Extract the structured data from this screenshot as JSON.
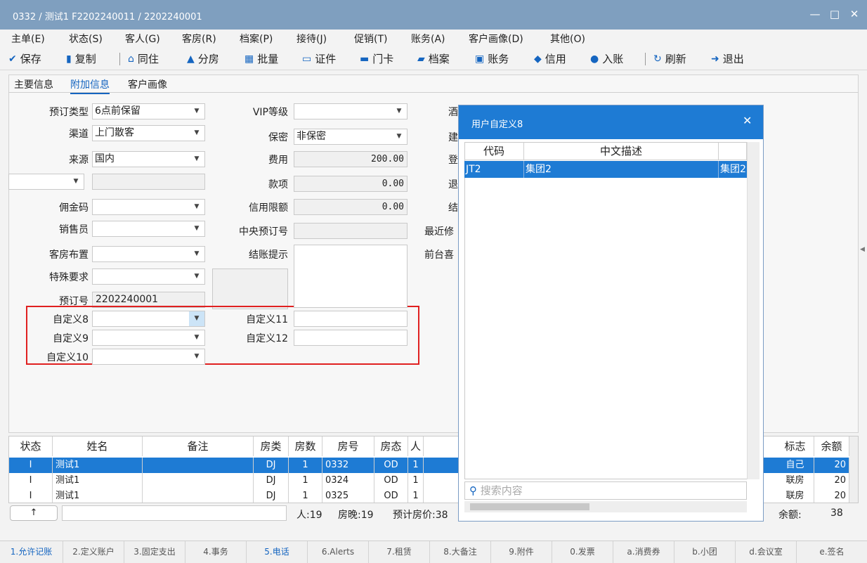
{
  "window": {
    "title": "0332 / 测试1 F2202240011 / 2202240001",
    "min": "—",
    "max": "□",
    "close": "✕"
  },
  "menu": [
    "主单(E)",
    "状态(S)",
    "客人(G)",
    "客房(R)",
    "档案(P)",
    "接待(J)",
    "促销(T)",
    "账务(A)",
    "客户画像(D)",
    "其他(O)"
  ],
  "toolbar": {
    "save": "保存",
    "copy": "复制",
    "cohabit": "同住",
    "split": "分房",
    "batch": "批量",
    "cert": "证件",
    "card": "门卡",
    "archive": "档案",
    "account": "账务",
    "credit": "信用",
    "post": "入账",
    "refresh": "刷新",
    "exit": "退出"
  },
  "tabs": {
    "main": "主要信息",
    "extra": "附加信息",
    "profile": "客户画像"
  },
  "form": {
    "booking_type_label": "预订类型",
    "booking_type": "6点前保留",
    "channel_label": "渠道",
    "channel": "上门散客",
    "source_label": "来源",
    "source": "国内",
    "commission_label": "佣金码",
    "sales_label": "销售员",
    "room_layout_label": "客房布置",
    "special_label": "特殊要求",
    "booking_no_label": "预订号",
    "booking_no": "2202240001",
    "vip_label": "VIP等级",
    "secret_label": "保密",
    "secret": "非保密",
    "fee_label": "费用",
    "fee": "200.00",
    "item_label": "款项",
    "item": "0.00",
    "credit_limit_label": "信用限额",
    "credit_limit": "0.00",
    "central_label": "中央预订号",
    "checkout_tip_label": "结账提示",
    "recent_label": "最近修",
    "front_label": "前台喜",
    "c1": "酒",
    "c2": "建",
    "c3": "登",
    "c4": "退",
    "c5": "结",
    "custom8": "自定义8",
    "custom9": "自定义9",
    "custom10": "自定义10",
    "custom11": "自定义11",
    "custom12": "自定义12"
  },
  "popup": {
    "title": "用户自定义8",
    "col_code": "代码",
    "col_desc": "中文描述",
    "row_code": "JT2",
    "row_desc": "集团2",
    "row_extra": "集团2",
    "search": "搜索内容"
  },
  "grid": {
    "headers": {
      "status": "状态",
      "name": "姓名",
      "note": "备注",
      "rtype": "房类",
      "rcount": "房数",
      "rno": "房号",
      "rstate": "房态",
      "person": "人",
      "flag": "标志",
      "balance": "余额"
    },
    "rows": [
      {
        "status": "I",
        "name": "测试1",
        "rtype": "DJ",
        "rcount": "1",
        "rno": "0332",
        "rstate": "OD",
        "person": "1",
        "flag": "自己",
        "balance": "20"
      },
      {
        "status": "I",
        "name": "测试1",
        "rtype": "DJ",
        "rcount": "1",
        "rno": "0324",
        "rstate": "OD",
        "person": "1",
        "flag": "联房",
        "balance": "20"
      },
      {
        "status": "I",
        "name": "测试1",
        "rtype": "DJ",
        "rcount": "1",
        "rno": "0325",
        "rstate": "OD",
        "person": "1",
        "flag": "联房",
        "balance": "20"
      }
    ]
  },
  "summary": {
    "up": "↑",
    "people": "人:19",
    "nights": "房晚:19",
    "price": "预计房价:38",
    "balance_label": "余额:",
    "balance": "38"
  },
  "bottom": [
    "1.允许记账",
    "2.定义账户",
    "3.固定支出",
    "4.事务",
    "5.电话",
    "6.Alerts",
    "7.租赁",
    "8.大备注",
    "9.附件",
    "0.发票",
    "a.消费券",
    "b.小团",
    "d.会议室",
    "e.签名"
  ]
}
